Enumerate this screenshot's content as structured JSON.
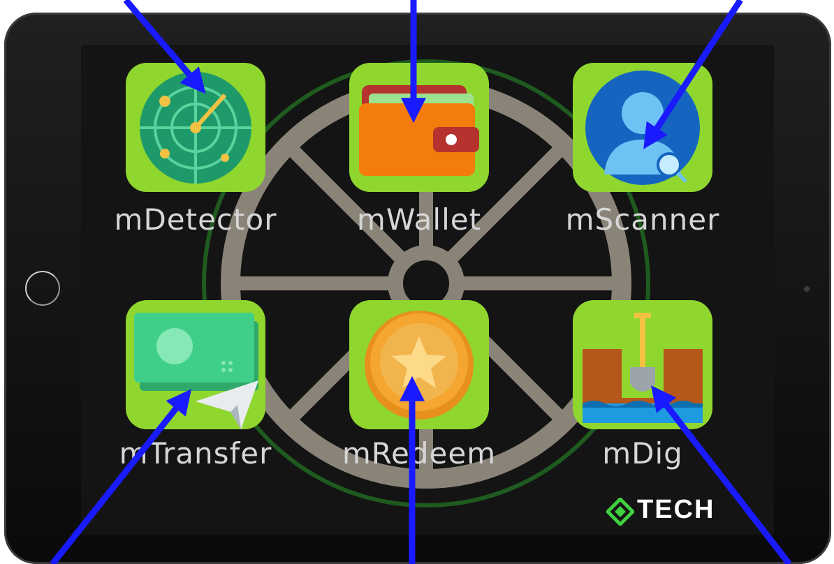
{
  "apps": [
    {
      "label": "mDetector",
      "icon": "radar-icon"
    },
    {
      "label": "mWallet",
      "icon": "wallet-icon"
    },
    {
      "label": "mScanner",
      "icon": "user-search-icon"
    },
    {
      "label": "mTransfer",
      "icon": "money-transfer-icon"
    },
    {
      "label": "mRedeem",
      "icon": "star-coin-icon"
    },
    {
      "label": "mDig",
      "icon": "shovel-dig-icon"
    }
  ],
  "brand": {
    "text": "TECH",
    "icon": "diamond-logo-icon"
  },
  "colors": {
    "app_tile": "#8fd62f",
    "arrow": "#1a1aff",
    "wheel": "#8a8478",
    "label_text": "#d6d6d6"
  }
}
